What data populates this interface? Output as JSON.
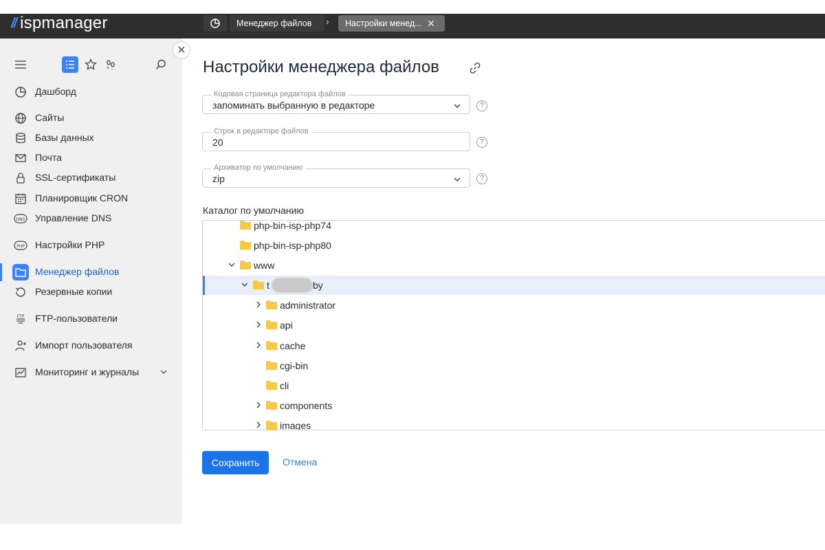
{
  "app": {
    "logo_text": "ispmanager"
  },
  "breadcrumbs": {
    "items": [
      {
        "label": "Менеджер файлов"
      },
      {
        "label": "Настройки менед..."
      }
    ]
  },
  "sidebar": {
    "items": [
      {
        "label": "Дашборд",
        "icon": "dashboard-icon"
      },
      {
        "label": "Сайты",
        "icon": "globe-icon"
      },
      {
        "label": "Базы данных",
        "icon": "database-icon"
      },
      {
        "label": "Почта",
        "icon": "mail-icon"
      },
      {
        "label": "SSL-сертификаты",
        "icon": "lock-icon"
      },
      {
        "label": "Планировщик CRON",
        "icon": "calendar-icon"
      },
      {
        "label": "Управление DNS",
        "icon": "dns-icon"
      },
      {
        "label": "Настройки PHP",
        "icon": "php-icon"
      },
      {
        "label": "Менеджер файлов",
        "icon": "folder-icon",
        "active": true
      },
      {
        "label": "Резервные копии",
        "icon": "backup-icon"
      },
      {
        "label": "FTP-пользователи",
        "icon": "ftp-icon"
      },
      {
        "label": "Импорт пользователя",
        "icon": "user-import-icon"
      },
      {
        "label": "Мониторинг и журналы",
        "icon": "monitoring-icon"
      }
    ]
  },
  "main": {
    "title": "Настройки менеджера файлов",
    "fields": [
      {
        "label": "Кодовая страница редактора файлов",
        "value": "запоминать выбранную в редакторе",
        "type": "select"
      },
      {
        "label": "Строк в редакторе файлов",
        "value": "20",
        "type": "input"
      },
      {
        "label": "Архиватор по умолчанию",
        "value": "zip",
        "type": "select"
      }
    ],
    "tree_label": "Каталог по умолчанию",
    "tree": [
      {
        "name": "php-bin-isp-php74"
      },
      {
        "name": "php-bin-isp-php80"
      },
      {
        "name": "www"
      },
      {
        "name_prefix": "t",
        "name_suffix": "by"
      },
      {
        "name": "administrator"
      },
      {
        "name": "api"
      },
      {
        "name": "cache"
      },
      {
        "name": "cgi-bin"
      },
      {
        "name": "cli"
      },
      {
        "name": "components"
      },
      {
        "name": "images"
      }
    ],
    "save_label": "Сохранить",
    "cancel_label": "Отмена"
  },
  "colors": {
    "accent": "#3b82f6",
    "topbar": "#2e2e2e",
    "sidebar": "#f0f0f0",
    "folder": "#f7c948"
  }
}
